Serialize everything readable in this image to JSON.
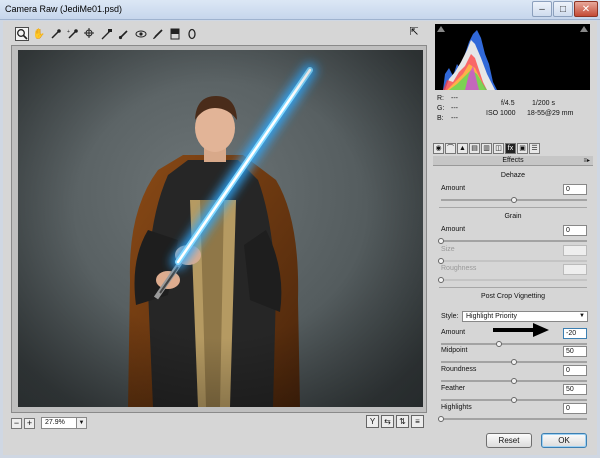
{
  "window": {
    "title": "Camera Raw (JediMe01.psd)"
  },
  "toolbar": {
    "tools": [
      {
        "name": "zoom-tool",
        "glyph": "🔍"
      },
      {
        "name": "hand-tool",
        "glyph": "✋"
      },
      {
        "name": "white-balance-tool",
        "glyph": "✒"
      },
      {
        "name": "color-sampler-tool",
        "glyph": "✒"
      },
      {
        "name": "targeted-adjustment-tool",
        "glyph": "⊕"
      },
      {
        "name": "straighten-tool",
        "glyph": "✎"
      },
      {
        "name": "spot-removal-tool",
        "glyph": "✎"
      },
      {
        "name": "red-eye-tool",
        "glyph": "◎"
      },
      {
        "name": "adjustment-brush-tool",
        "glyph": "✎"
      },
      {
        "name": "graduated-filter-tool",
        "glyph": "▥"
      },
      {
        "name": "radial-filter-tool",
        "glyph": "◯"
      }
    ]
  },
  "zoom": {
    "value": "27.9%"
  },
  "info": {
    "r_label": "R:",
    "r_value": "---",
    "g_label": "G:",
    "g_value": "---",
    "b_label": "B:",
    "b_value": "---",
    "aperture": "f/4.5",
    "shutter": "1/200 s",
    "iso": "ISO 1000",
    "lens": "18-55@29 mm"
  },
  "panel": {
    "title": "Effects"
  },
  "dehaze": {
    "title": "Dehaze",
    "amount_label": "Amount",
    "amount_value": "0",
    "amount_fraction": 0.5
  },
  "grain": {
    "title": "Grain",
    "amount_label": "Amount",
    "amount_value": "0",
    "amount_fraction": 0.0,
    "size_label": "Size",
    "size_value": "",
    "size_fraction": 0.0,
    "roughness_label": "Roughness",
    "roughness_value": "",
    "roughness_fraction": 0.0
  },
  "vignetting": {
    "title": "Post Crop Vignetting",
    "style_label": "Style:",
    "style_value": "Highlight Priority",
    "amount_label": "Amount",
    "amount_value": "-20",
    "amount_fraction": 0.4,
    "midpoint_label": "Midpoint",
    "midpoint_value": "50",
    "midpoint_fraction": 0.5,
    "roundness_label": "Roundness",
    "roundness_value": "0",
    "roundness_fraction": 0.5,
    "feather_label": "Feather",
    "feather_value": "50",
    "feather_fraction": 0.5,
    "highlights_label": "Highlights",
    "highlights_value": "0",
    "highlights_fraction": 0.0
  },
  "buttons": {
    "reset": "Reset",
    "ok": "OK"
  },
  "colors": {
    "accent": "#3c7fb1",
    "lightsaber": "#4fc3ff"
  }
}
